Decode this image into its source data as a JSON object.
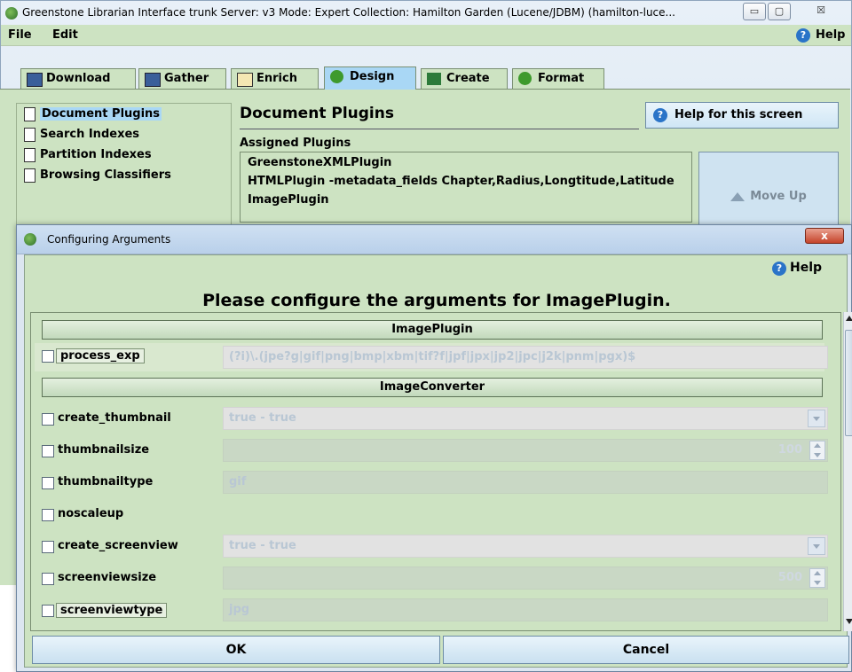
{
  "main_window": {
    "title": "Greenstone Librarian Interface trunk  Server: v3  Mode: Expert  Collection: Hamilton Garden (Lucene/JDBM) (hamilton-luce...",
    "controls": {
      "minimize": "▭",
      "maximize": "▢",
      "close": "☒"
    }
  },
  "menubar": {
    "file": "File",
    "edit": "Edit",
    "help": "Help"
  },
  "tabs": [
    {
      "label": "Download",
      "icon": "download-icon"
    },
    {
      "label": "Gather",
      "icon": "gather-icon"
    },
    {
      "label": "Enrich",
      "icon": "enrich-icon"
    },
    {
      "label": "Design",
      "icon": "gear-icon",
      "active": true
    },
    {
      "label": "Create",
      "icon": "create-icon"
    },
    {
      "label": "Format",
      "icon": "gear-icon"
    }
  ],
  "sidebar": {
    "items": [
      {
        "label": "Document Plugins",
        "selected": true
      },
      {
        "label": "Search Indexes"
      },
      {
        "label": "Partition Indexes"
      },
      {
        "label": "Browsing Classifiers"
      }
    ]
  },
  "design": {
    "title": "Document Plugins",
    "help_button": "Help for this screen",
    "assigned_label": "Assigned Plugins",
    "plugins": [
      "GreenstoneXMLPlugin",
      "HTMLPlugin -metadata_fields Chapter,Radius,Longtitude,Latitude",
      "ImagePlugin"
    ],
    "move_up": "Move Up"
  },
  "dialog": {
    "title": "Configuring Arguments",
    "close": "x",
    "help": "Help",
    "heading": "Please configure the arguments for ImagePlugin.",
    "sections": [
      {
        "label": "ImagePlugin"
      },
      {
        "label": "ImageConverter"
      }
    ],
    "args": [
      {
        "name": "process_exp",
        "value": "(?i)\\.(jpe?g|gif|png|bmp|xbm|tif?f|jpf|jpx|jp2|jpc|j2k|pnm|pgx)$"
      },
      {
        "name": "create_thumbnail",
        "value": "true - true"
      },
      {
        "name": "thumbnailsize",
        "value": "100"
      },
      {
        "name": "thumbnailtype",
        "value": "gif"
      },
      {
        "name": "noscaleup",
        "value": ""
      },
      {
        "name": "create_screenview",
        "value": "true - true"
      },
      {
        "name": "screenviewsize",
        "value": "500"
      },
      {
        "name": "screenviewtype",
        "value": "jpg"
      }
    ],
    "ok": "OK",
    "cancel": "Cancel"
  },
  "colors": {
    "panel_green": "#cde3c2",
    "tab_active_blue": "#a9d7f5",
    "help_blue": "#2a74c8"
  }
}
